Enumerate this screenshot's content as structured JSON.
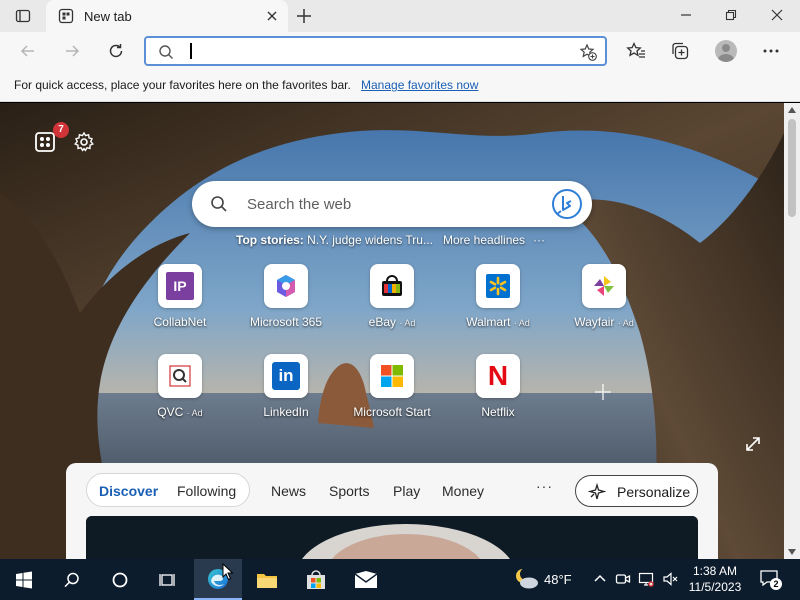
{
  "browser": {
    "tab": {
      "title": "New tab"
    },
    "address_bar": {
      "value": "",
      "placeholder": ""
    },
    "favorites_bar": {
      "message": "For quick access, place your favorites here on the favorites bar.",
      "link": "Manage favorites now"
    }
  },
  "newtab": {
    "notification_count": "7",
    "search": {
      "placeholder": "Search the web"
    },
    "headlines": {
      "top_stories_label": "Top stories:",
      "top_story": "N.Y. judge widens Tru...",
      "more": "More headlines",
      "menu": "···"
    },
    "quick_links": [
      {
        "label": "CollabNet",
        "ad": ""
      },
      {
        "label": "Microsoft 365",
        "ad": ""
      },
      {
        "label": "eBay",
        "ad": "· Ad"
      },
      {
        "label": "Walmart",
        "ad": "· Ad"
      },
      {
        "label": "Wayfair",
        "ad": "· Ad"
      },
      {
        "label": "QVC",
        "ad": "· Ad"
      },
      {
        "label": "LinkedIn",
        "ad": ""
      },
      {
        "label": "Microsoft Start",
        "ad": ""
      },
      {
        "label": "Netflix",
        "ad": ""
      }
    ],
    "quick_link_icons": {
      "collabnet": "IP",
      "linkedin": "in",
      "netflix": "N"
    },
    "feed": {
      "tabs": [
        "Discover",
        "Following",
        "News",
        "Sports",
        "Play",
        "Money"
      ],
      "active_tab": "Discover",
      "more": "···",
      "personalize": "Personalize"
    }
  },
  "taskbar": {
    "weather_temp": "48°F",
    "time": "1:38 AM",
    "date": "11/5/2023",
    "notification_count": "2"
  },
  "colors": {
    "accent": "#1a5fb4",
    "badge": "#d13438",
    "taskbar": "#0d1c2d"
  }
}
